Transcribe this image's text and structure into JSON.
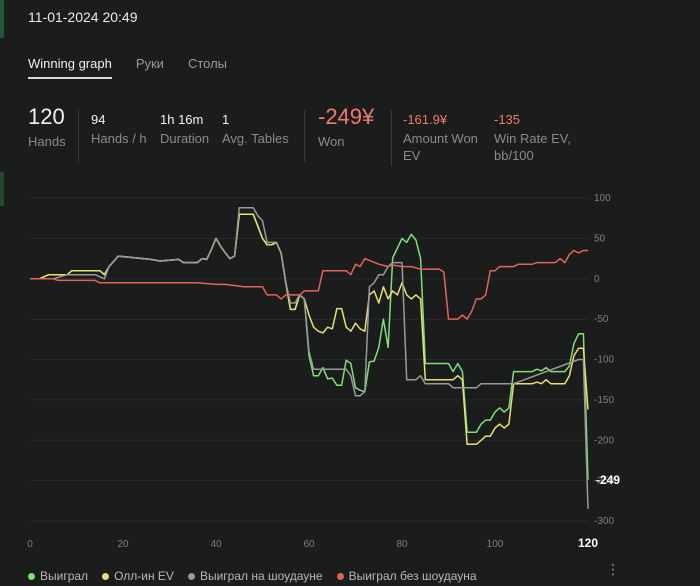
{
  "header": {
    "session_time": "11-01-2024 20:49"
  },
  "tabs": [
    {
      "label": "Winning graph",
      "active": true
    },
    {
      "label": "Руки",
      "active": false
    },
    {
      "label": "Столы",
      "active": false
    }
  ],
  "stats": {
    "hands": {
      "value": "120",
      "label": "Hands"
    },
    "hands_per_hour": {
      "value": "94",
      "label": "Hands / h"
    },
    "duration": {
      "value": "1h 16m",
      "label": "Duration"
    },
    "avg_tables": {
      "value": "1",
      "label": "Avg. Tables"
    },
    "won": {
      "value": "-249¥",
      "label": "Won"
    },
    "amount_won_ev": {
      "value": "-161.9¥",
      "label": "Amount Won EV"
    },
    "win_rate_ev": {
      "value": "-135",
      "label": "Win Rate EV, bb/100"
    }
  },
  "colors": {
    "won": "#7fe07a",
    "allin_ev": "#e8e070",
    "showdown": "#9a9a9a",
    "non_showdown": "#e8605a",
    "accent_red": "#f07a70"
  },
  "chart_data": {
    "type": "line",
    "title": "",
    "xlabel": "",
    "ylabel": "",
    "xlim": [
      0,
      120
    ],
    "ylim": [
      -300,
      100
    ],
    "x_ticks": [
      0,
      20,
      40,
      60,
      80,
      100,
      120
    ],
    "y_ticks": [
      100,
      50,
      0,
      -50,
      -100,
      -150,
      -200,
      -250,
      -300
    ],
    "grid": true,
    "legend_position": "bottom-left",
    "end_labels": {
      "x": "120",
      "y": "-249"
    },
    "series": [
      {
        "name": "Выиграл",
        "color": "#7fe07a",
        "points": [
          [
            0,
            0
          ],
          [
            2,
            0
          ],
          [
            4,
            5
          ],
          [
            8,
            5
          ],
          [
            9,
            10
          ],
          [
            15,
            10
          ],
          [
            16,
            5
          ],
          [
            17,
            15
          ],
          [
            19,
            28
          ],
          [
            26,
            24
          ],
          [
            28,
            22
          ],
          [
            32,
            24
          ],
          [
            33,
            20
          ],
          [
            36,
            20
          ],
          [
            37,
            25
          ],
          [
            38,
            24
          ],
          [
            39,
            36
          ],
          [
            40,
            50
          ],
          [
            41,
            40
          ],
          [
            42,
            32
          ],
          [
            43,
            25
          ],
          [
            44,
            28
          ],
          [
            45,
            80
          ],
          [
            48,
            80
          ],
          [
            49,
            65
          ],
          [
            50,
            50
          ],
          [
            51,
            42
          ],
          [
            52,
            42
          ],
          [
            53,
            45
          ],
          [
            54,
            32
          ],
          [
            55,
            -5
          ],
          [
            56,
            -38
          ],
          [
            57,
            -38
          ],
          [
            58,
            -20
          ],
          [
            59,
            -25
          ],
          [
            60,
            -95
          ],
          [
            61,
            -120
          ],
          [
            62,
            -120
          ],
          [
            63,
            -110
          ],
          [
            64,
            -124
          ],
          [
            65,
            -123
          ],
          [
            66,
            -132
          ],
          [
            67,
            -132
          ],
          [
            68,
            -101
          ],
          [
            69,
            -105
          ],
          [
            70,
            -135
          ],
          [
            71,
            -138
          ],
          [
            72,
            -140
          ],
          [
            73,
            -103
          ],
          [
            74,
            -102
          ],
          [
            75,
            -85
          ],
          [
            76,
            -50
          ],
          [
            77,
            -85
          ],
          [
            78,
            26
          ],
          [
            79,
            38
          ],
          [
            80,
            50
          ],
          [
            81,
            45
          ],
          [
            82,
            55
          ],
          [
            83,
            48
          ],
          [
            84,
            25
          ],
          [
            85,
            -105
          ],
          [
            90,
            -105
          ],
          [
            91,
            -115
          ],
          [
            92,
            -105
          ],
          [
            93,
            -115
          ],
          [
            94,
            -190
          ],
          [
            96,
            -190
          ],
          [
            97,
            -180
          ],
          [
            98,
            -175
          ],
          [
            99,
            -175
          ],
          [
            100,
            -165
          ],
          [
            101,
            -160
          ],
          [
            102,
            -165
          ],
          [
            103,
            -160
          ],
          [
            104,
            -115
          ],
          [
            108,
            -115
          ],
          [
            109,
            -112
          ],
          [
            110,
            -114
          ],
          [
            111,
            -110
          ],
          [
            112,
            -115
          ],
          [
            115,
            -115
          ],
          [
            116,
            -108
          ],
          [
            117,
            -80
          ],
          [
            118,
            -68
          ],
          [
            119,
            -68
          ],
          [
            120,
            -249
          ]
        ]
      },
      {
        "name": "Олл-ин EV",
        "color": "#e8e070",
        "points": [
          [
            0,
            0
          ],
          [
            2,
            0
          ],
          [
            4,
            5
          ],
          [
            8,
            5
          ],
          [
            9,
            10
          ],
          [
            15,
            10
          ],
          [
            16,
            5
          ],
          [
            17,
            15
          ],
          [
            19,
            28
          ],
          [
            26,
            24
          ],
          [
            28,
            22
          ],
          [
            32,
            24
          ],
          [
            33,
            20
          ],
          [
            36,
            20
          ],
          [
            37,
            25
          ],
          [
            38,
            24
          ],
          [
            39,
            36
          ],
          [
            40,
            50
          ],
          [
            41,
            40
          ],
          [
            42,
            32
          ],
          [
            43,
            25
          ],
          [
            44,
            28
          ],
          [
            45,
            80
          ],
          [
            48,
            80
          ],
          [
            49,
            65
          ],
          [
            50,
            50
          ],
          [
            51,
            42
          ],
          [
            52,
            42
          ],
          [
            53,
            45
          ],
          [
            54,
            32
          ],
          [
            55,
            -5
          ],
          [
            56,
            -38
          ],
          [
            57,
            -38
          ],
          [
            58,
            -20
          ],
          [
            59,
            -25
          ],
          [
            60,
            -45
          ],
          [
            61,
            -60
          ],
          [
            62,
            -65
          ],
          [
            63,
            -67
          ],
          [
            64,
            -60
          ],
          [
            65,
            -62
          ],
          [
            66,
            -37
          ],
          [
            67,
            -37
          ],
          [
            68,
            -60
          ],
          [
            69,
            -65
          ],
          [
            70,
            -55
          ],
          [
            71,
            -62
          ],
          [
            72,
            -65
          ],
          [
            73,
            -20
          ],
          [
            74,
            -15
          ],
          [
            75,
            -30
          ],
          [
            76,
            -10
          ],
          [
            77,
            -25
          ],
          [
            78,
            -15
          ],
          [
            79,
            -20
          ],
          [
            80,
            -5
          ],
          [
            81,
            -20
          ],
          [
            82,
            -25
          ],
          [
            83,
            -20
          ],
          [
            84,
            -25
          ],
          [
            85,
            -125
          ],
          [
            90,
            -125
          ],
          [
            91,
            -125
          ],
          [
            92,
            -120
          ],
          [
            93,
            -125
          ],
          [
            94,
            -205
          ],
          [
            96,
            -205
          ],
          [
            97,
            -200
          ],
          [
            98,
            -195
          ],
          [
            99,
            -195
          ],
          [
            100,
            -185
          ],
          [
            101,
            -180
          ],
          [
            102,
            -185
          ],
          [
            103,
            -180
          ],
          [
            104,
            -130
          ],
          [
            108,
            -130
          ],
          [
            109,
            -128
          ],
          [
            110,
            -130
          ],
          [
            111,
            -125
          ],
          [
            112,
            -130
          ],
          [
            115,
            -130
          ],
          [
            116,
            -120
          ],
          [
            117,
            -95
          ],
          [
            118,
            -86
          ],
          [
            119,
            -86
          ],
          [
            120,
            -161.9
          ]
        ]
      },
      {
        "name": "Выиграл на шоудауне",
        "color": "#9a9a9a",
        "points": [
          [
            0,
            0
          ],
          [
            2,
            0
          ],
          [
            5,
            0
          ],
          [
            8,
            5
          ],
          [
            14,
            5
          ],
          [
            16,
            0
          ],
          [
            17,
            15
          ],
          [
            19,
            28
          ],
          [
            26,
            24
          ],
          [
            28,
            22
          ],
          [
            32,
            24
          ],
          [
            33,
            20
          ],
          [
            36,
            20
          ],
          [
            37,
            25
          ],
          [
            38,
            24
          ],
          [
            39,
            36
          ],
          [
            40,
            50
          ],
          [
            41,
            40
          ],
          [
            42,
            32
          ],
          [
            43,
            25
          ],
          [
            44,
            28
          ],
          [
            45,
            88
          ],
          [
            48,
            88
          ],
          [
            49,
            78
          ],
          [
            50,
            72
          ],
          [
            51,
            45
          ],
          [
            53,
            45
          ],
          [
            54,
            32
          ],
          [
            55,
            -5
          ],
          [
            56,
            -30
          ],
          [
            57,
            -30
          ],
          [
            58,
            -20
          ],
          [
            59,
            -25
          ],
          [
            60,
            -90
          ],
          [
            61,
            -112
          ],
          [
            62,
            -112
          ],
          [
            68,
            -112
          ],
          [
            69,
            -120
          ],
          [
            70,
            -145
          ],
          [
            71,
            -145
          ],
          [
            72,
            -140
          ],
          [
            73,
            -10
          ],
          [
            74,
            -5
          ],
          [
            75,
            5
          ],
          [
            76,
            5
          ],
          [
            77,
            15
          ],
          [
            78,
            20
          ],
          [
            80,
            20
          ],
          [
            81,
            -125
          ],
          [
            83,
            -125
          ],
          [
            84,
            -120
          ],
          [
            85,
            -130
          ],
          [
            90,
            -130
          ],
          [
            91,
            -135
          ],
          [
            96,
            -135
          ],
          [
            97,
            -130
          ],
          [
            104,
            -130
          ],
          [
            118,
            -100
          ],
          [
            119,
            -100
          ],
          [
            120,
            -285
          ]
        ]
      },
      {
        "name": "Выиграл без шоудауна",
        "color": "#e8605a",
        "points": [
          [
            0,
            0
          ],
          [
            5,
            0
          ],
          [
            6,
            -2
          ],
          [
            14,
            -2
          ],
          [
            15,
            -5
          ],
          [
            18,
            -5
          ],
          [
            28,
            -5
          ],
          [
            36,
            -5
          ],
          [
            40,
            -7
          ],
          [
            42,
            -7
          ],
          [
            46,
            -10
          ],
          [
            50,
            -10
          ],
          [
            51,
            -20
          ],
          [
            53,
            -20
          ],
          [
            54,
            -25
          ],
          [
            55,
            -20
          ],
          [
            58,
            -20
          ],
          [
            59,
            -15
          ],
          [
            62,
            -15
          ],
          [
            63,
            10
          ],
          [
            65,
            10
          ],
          [
            66,
            10
          ],
          [
            68,
            10
          ],
          [
            69,
            5
          ],
          [
            70,
            18
          ],
          [
            71,
            15
          ],
          [
            72,
            25
          ],
          [
            75,
            18
          ],
          [
            77,
            15
          ],
          [
            78,
            17
          ],
          [
            80,
            15
          ],
          [
            82,
            15
          ],
          [
            84,
            12
          ],
          [
            88,
            12
          ],
          [
            89,
            8
          ],
          [
            90,
            -50
          ],
          [
            92,
            -50
          ],
          [
            93,
            -45
          ],
          [
            94,
            -50
          ],
          [
            95,
            -40
          ],
          [
            96,
            -25
          ],
          [
            97,
            -25
          ],
          [
            98,
            -20
          ],
          [
            99,
            10
          ],
          [
            100,
            10
          ],
          [
            101,
            15
          ],
          [
            104,
            15
          ],
          [
            105,
            18
          ],
          [
            108,
            18
          ],
          [
            109,
            20
          ],
          [
            113,
            20
          ],
          [
            114,
            25
          ],
          [
            115,
            20
          ],
          [
            116,
            30
          ],
          [
            117,
            35
          ],
          [
            118,
            32
          ],
          [
            119,
            35
          ],
          [
            120,
            35
          ]
        ]
      }
    ]
  },
  "legend": {
    "items": [
      {
        "label": "Выиграл",
        "color": "#7fe07a"
      },
      {
        "label": "Олл-ин EV",
        "color": "#e8e070"
      },
      {
        "label": "Выиграл на шоудауне",
        "color": "#9a9a9a"
      },
      {
        "label": "Выиграл без шоудауна",
        "color": "#e8605a"
      }
    ],
    "more_icon": "vertical-dots-icon"
  }
}
